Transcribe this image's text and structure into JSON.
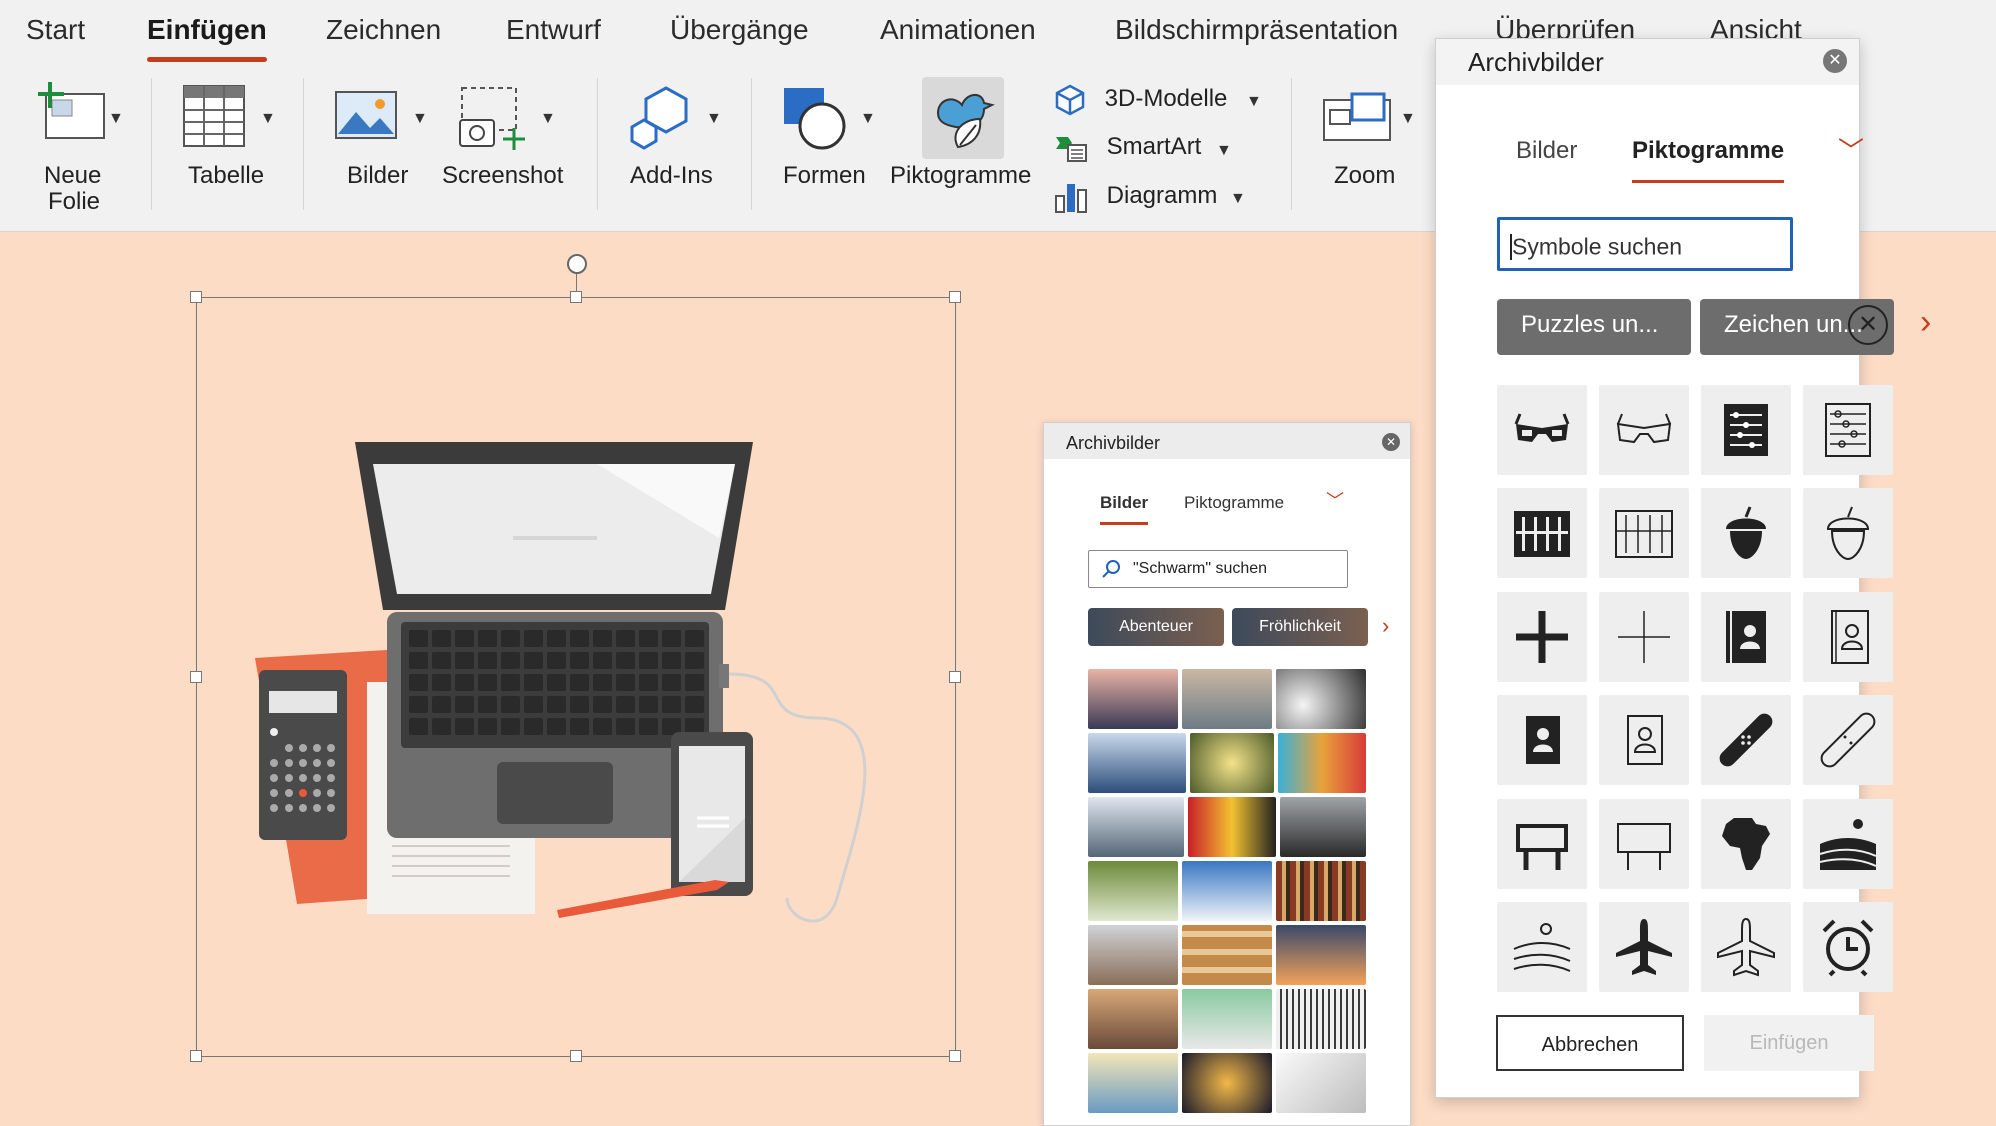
{
  "ribbon": {
    "menu_tabs": [
      "Start",
      "Einfügen",
      "Zeichnen",
      "Entwurf",
      "Übergänge",
      "Animationen",
      "Bildschirmpräsentation",
      "Überprüfen",
      "Ansicht"
    ],
    "active_tab": "Einfügen",
    "items": {
      "neue_folie_line1": "Neue",
      "neue_folie_line2": "Folie",
      "tabelle": "Tabelle",
      "bilder": "Bilder",
      "screenshot": "Screenshot",
      "add_ins": "Add-Ins",
      "formen": "Formen",
      "piktogramme": "Piktogramme",
      "modelle_3d": "3D-Modelle",
      "smartart": "SmartArt",
      "diagramm": "Diagramm",
      "zoom": "Zoom"
    },
    "accent_color": "#c43e1c"
  },
  "small_panel": {
    "title": "Archivbilder",
    "tabs": [
      "Bilder",
      "Piktogramme"
    ],
    "active_tab": "Bilder",
    "search_value": "\"Schwarm\" suchen",
    "chips": [
      "Abenteuer",
      "Fröhlichkeit"
    ]
  },
  "big_panel": {
    "title": "Archivbilder",
    "tabs": [
      "Bilder",
      "Piktogramme"
    ],
    "active_tab": "Piktogramme",
    "search_placeholder": "Symbole suchen",
    "chips": [
      "Puzzles un...",
      "Zeichen un..."
    ],
    "icons": [
      "3d-glasses-filled-icon",
      "3d-glasses-outline-icon",
      "abacus-filled-icon",
      "abacus-outline-icon",
      "abacus2-filled-icon",
      "abacus2-outline-icon",
      "acorn-filled-icon",
      "acorn-outline-icon",
      "plus-filled-icon",
      "plus-outline-icon",
      "address-book-filled-icon",
      "address-book-outline-icon",
      "contact-book-filled-icon",
      "contact-book-outline-icon",
      "bandage-filled-icon",
      "bandage-outline-icon",
      "billboard-filled-icon",
      "billboard-outline-icon",
      "africa-icon",
      "farm-filled-icon",
      "farm-outline-icon",
      "airplane-filled-icon",
      "airplane-outline-icon",
      "alarm-clock-icon"
    ],
    "cancel_label": "Abbrechen",
    "insert_label": "Einfügen",
    "accent_color": "#1f62b8"
  }
}
